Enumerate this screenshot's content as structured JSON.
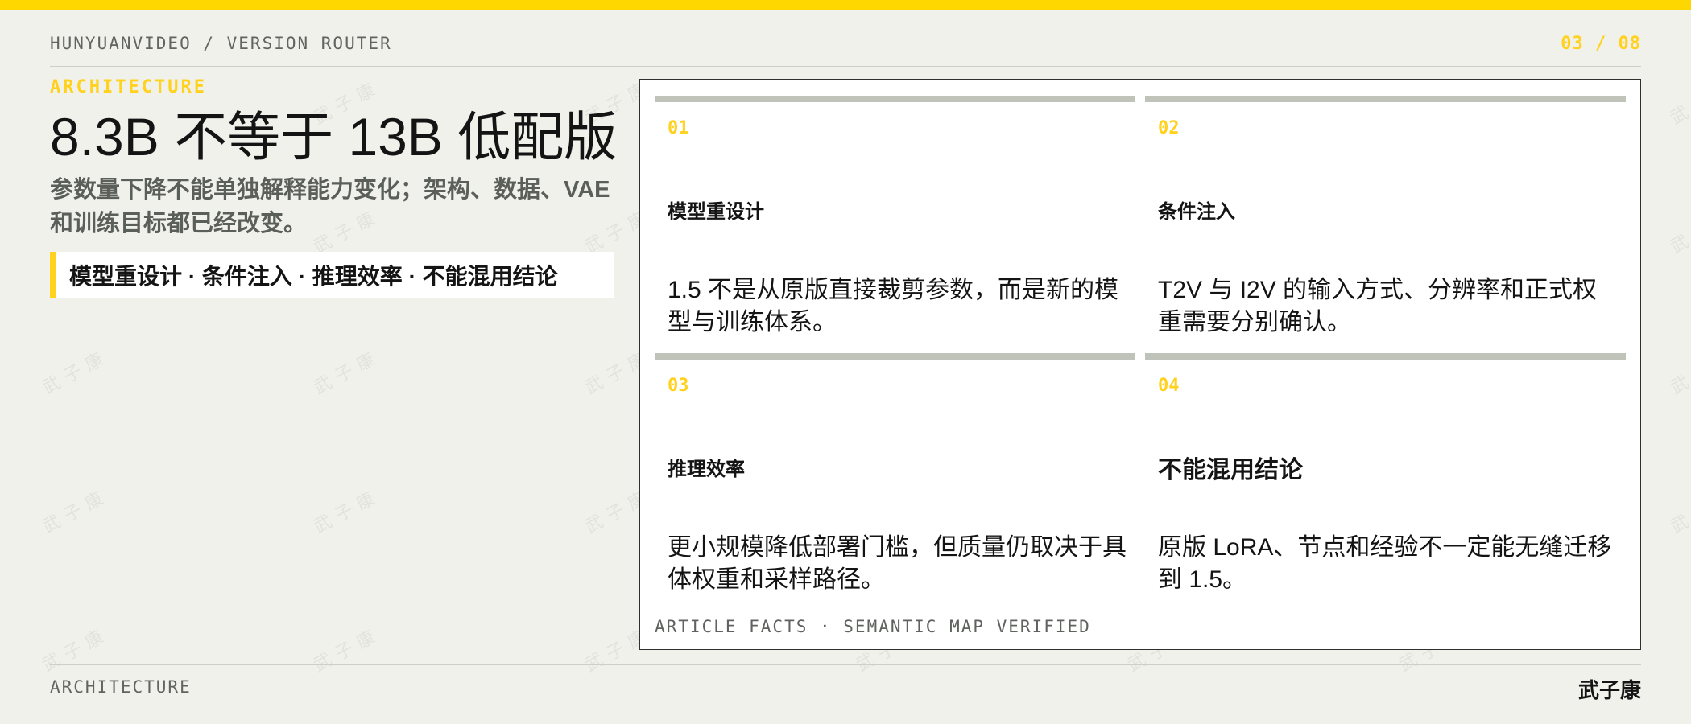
{
  "header": {
    "brand": "HUNYUANVIDEO / VERSION ROUTER",
    "page": "03 / 08"
  },
  "left": {
    "kicker": "ARCHITECTURE",
    "title": "8.3B 不等于 13B 低配版",
    "subtitle": "参数量下降不能单独解释能力变化；架构、数据、VAE 和训练目标都已经改变。",
    "callout": "模型重设计 · 条件注入 · 推理效率 · 不能混用结论"
  },
  "cards": [
    {
      "num": "01",
      "heading": "模型重设计",
      "text": "1.5 不是从原版直接裁剪参数，而是新的模型与训练体系。"
    },
    {
      "num": "02",
      "heading": "条件注入",
      "text": "T2V 与 I2V 的输入方式、分辨率和正式权重需要分别确认。"
    },
    {
      "num": "03",
      "heading": "推理效率",
      "text": "更小规模降低部署门槛，但质量仍取决于具体权重和采样路径。"
    },
    {
      "num": "04",
      "heading": "不能混用结论",
      "text": "原版 LoRA、节点和经验不一定能无缝迁移到 1.5。"
    }
  ],
  "panel": {
    "footer": "ARTICLE FACTS · SEMANTIC MAP VERIFIED"
  },
  "footer": {
    "section": "ARCHITECTURE",
    "author": "武子康"
  },
  "watermark": {
    "text": "武子康"
  },
  "colors": {
    "accent": "#ffd700",
    "background": "#f1f1ec",
    "card_rule": "#bfc3ba"
  }
}
